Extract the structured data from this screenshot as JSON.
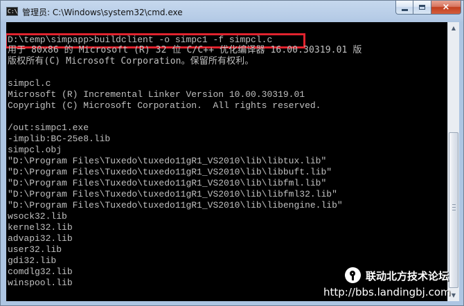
{
  "window": {
    "title": "管理员: C:\\Windows\\system32\\cmd.exe",
    "icon_text": "C:\\",
    "controls": {
      "minimize": "minimize-icon",
      "maximize": "maximize-icon",
      "close": "×"
    }
  },
  "console": {
    "lines": [
      "",
      "D:\\temp\\simpapp>buildclient -o simpc1 -f simpcl.c",
      "用于 80x86 的 Microsoft (R) 32 位 C/C++ 优化编译器 16.00.30319.01 版",
      "版权所有(C) Microsoft Corporation。保留所有权利。",
      "",
      "simpcl.c",
      "Microsoft (R) Incremental Linker Version 10.00.30319.01",
      "Copyright (C) Microsoft Corporation.  All rights reserved.",
      "",
      "/out:simpc1.exe",
      "-implib:BC-25e8.lib",
      "simpcl.obj",
      "\"D:\\Program Files\\Tuxedo\\tuxedo11gR1_VS2010\\lib\\libtux.lib\"",
      "\"D:\\Program Files\\Tuxedo\\tuxedo11gR1_VS2010\\lib\\libbuft.lib\"",
      "\"D:\\Program Files\\Tuxedo\\tuxedo11gR1_VS2010\\lib\\libfml.lib\"",
      "\"D:\\Program Files\\Tuxedo\\tuxedo11gR1_VS2010\\lib\\libfml32.lib\"",
      "\"D:\\Program Files\\Tuxedo\\tuxedo11gR1_VS2010\\lib\\libengine.lib\"",
      "wsock32.lib",
      "kernel32.lib",
      "advapi32.lib",
      "user32.lib",
      "gdi32.lib",
      "comdlg32.lib",
      "winspool.lib"
    ]
  },
  "scrollbar": {
    "up_arrow": "▲",
    "down_arrow": "▼",
    "position_fraction": 0.43
  },
  "watermark": {
    "title": "联动北方技术论坛",
    "url": "http://bbs.landingbj.com"
  },
  "colors": {
    "console_background": "#000000",
    "console_text": "#c0c0c0",
    "highlight": "#e1232e",
    "window_frame": "#b5cbe6"
  }
}
